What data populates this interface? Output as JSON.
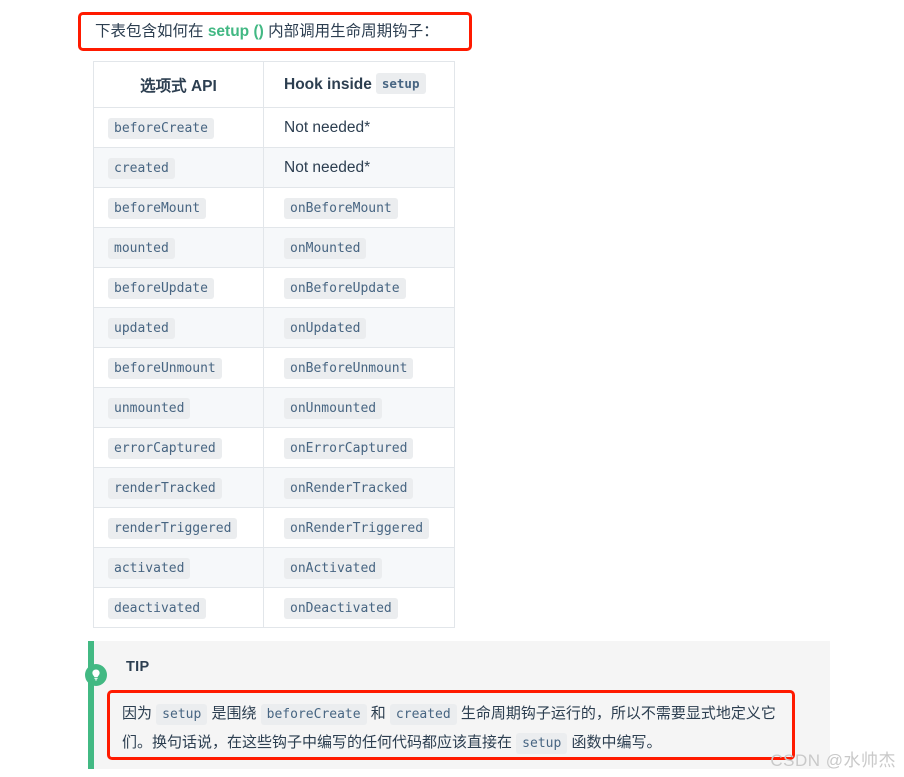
{
  "intro": {
    "before": "下表包含如何在 ",
    "code": "setup ()",
    "after": " 内部调用生命周期钩子："
  },
  "table": {
    "headers": {
      "col1": "选项式 API",
      "col2_text": "Hook inside",
      "col2_code": "setup"
    },
    "rows": [
      {
        "api": "beforeCreate",
        "hook": "Not needed*",
        "hook_is_code": false
      },
      {
        "api": "created",
        "hook": "Not needed*",
        "hook_is_code": false
      },
      {
        "api": "beforeMount",
        "hook": "onBeforeMount",
        "hook_is_code": true
      },
      {
        "api": "mounted",
        "hook": "onMounted",
        "hook_is_code": true
      },
      {
        "api": "beforeUpdate",
        "hook": "onBeforeUpdate",
        "hook_is_code": true
      },
      {
        "api": "updated",
        "hook": "onUpdated",
        "hook_is_code": true
      },
      {
        "api": "beforeUnmount",
        "hook": "onBeforeUnmount",
        "hook_is_code": true
      },
      {
        "api": "unmounted",
        "hook": "onUnmounted",
        "hook_is_code": true
      },
      {
        "api": "errorCaptured",
        "hook": "onErrorCaptured",
        "hook_is_code": true
      },
      {
        "api": "renderTracked",
        "hook": "onRenderTracked",
        "hook_is_code": true
      },
      {
        "api": "renderTriggered",
        "hook": "onRenderTriggered",
        "hook_is_code": true
      },
      {
        "api": "activated",
        "hook": "onActivated",
        "hook_is_code": true
      },
      {
        "api": "deactivated",
        "hook": "onDeactivated",
        "hook_is_code": true
      }
    ]
  },
  "tip": {
    "icon": "lightbulb-icon",
    "title": "TIP",
    "segments": [
      {
        "type": "text",
        "value": "因为 "
      },
      {
        "type": "code",
        "value": "setup"
      },
      {
        "type": "text",
        "value": " 是围绕 "
      },
      {
        "type": "code",
        "value": "beforeCreate"
      },
      {
        "type": "text",
        "value": " 和 "
      },
      {
        "type": "code",
        "value": "created"
      },
      {
        "type": "text",
        "value": " 生命周期钩子运行的，所以不需要显式地定义它们。换句话说，在这些钩子中编写的任何代码都应该直接在 "
      },
      {
        "type": "code",
        "value": "setup"
      },
      {
        "type": "text",
        "value": " 函数中编写。"
      }
    ]
  },
  "watermark": {
    "text": "CSDN @水帅杰"
  },
  "colors": {
    "vue_green": "#42b883",
    "annotation_red": "#ff1a00",
    "code_text": "#476582",
    "code_bg": "#ebedef",
    "stripe_bg": "#f6f8fa",
    "tip_bg": "#f5f5f5",
    "body_text": "#2c3e50"
  }
}
